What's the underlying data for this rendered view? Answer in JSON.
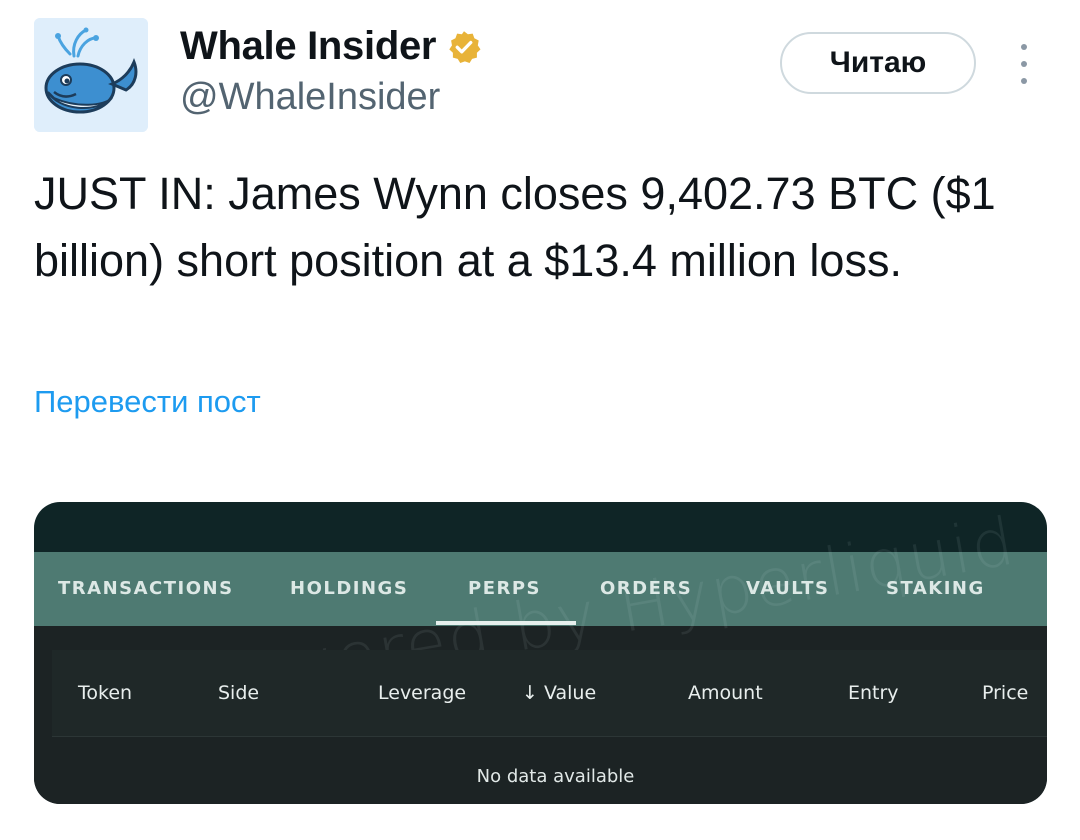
{
  "author": {
    "name": "Whale Insider",
    "handle": "@WhaleInsider",
    "verified_color": "#e8b339"
  },
  "follow_button": {
    "label": "Читаю"
  },
  "tweet": {
    "text": "JUST IN: James Wynn closes 9,402.73 BTC ($1 billion) short position at a $13.4 million loss.",
    "translate_label": "Перевести пост"
  },
  "media": {
    "tabs": [
      {
        "label": "TRANSACTIONS",
        "active": false
      },
      {
        "label": "HOLDINGS",
        "active": false
      },
      {
        "label": "PERPS",
        "active": true
      },
      {
        "label": "ORDERS",
        "active": false
      },
      {
        "label": "VAULTS",
        "active": false
      },
      {
        "label": "STAKING",
        "active": false
      }
    ],
    "columns": [
      "Token",
      "Side",
      "Leverage",
      "Value",
      "Amount",
      "Entry",
      "Price"
    ],
    "sort_icon": "arrow-down-icon",
    "empty_text": "No data available",
    "watermark": "Powered by Hyperliquid",
    "colors": {
      "header_bg": "#0f2526",
      "tab_bar": "#4e7a72",
      "panel_bg": "#1c2324"
    }
  }
}
